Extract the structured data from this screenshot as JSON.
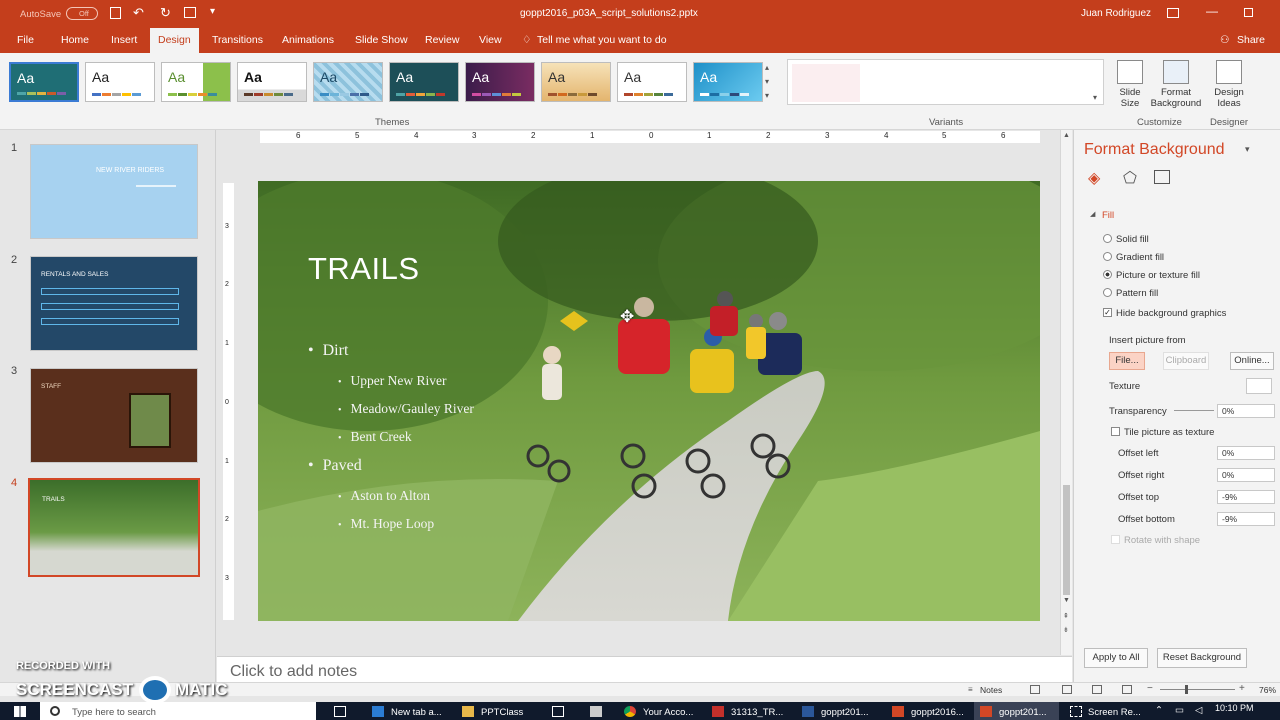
{
  "titlebar": {
    "autosave_label": "AutoSave",
    "autosave_state": "Off",
    "filename": "goppt2016_p03A_script_solutions2.pptx",
    "user": "Juan Rodriguez"
  },
  "tabs": [
    "File",
    "Home",
    "Insert",
    "Design",
    "Transitions",
    "Animations",
    "Slide Show",
    "Review",
    "View"
  ],
  "active_tab": "Design",
  "tell_me": "Tell me what you want to do",
  "share_label": "Share",
  "ribbon": {
    "themes_label": "Themes",
    "variants_label": "Variants",
    "customize_label": "Customize",
    "designer_label": "Designer",
    "theme_glyph": "Aa",
    "slide_size": "Slide Size",
    "format_background": "Format Background",
    "design_ideas": "Design Ideas"
  },
  "thumbnails": [
    {
      "num": "1",
      "title": "NEW RIVER RIDERS"
    },
    {
      "num": "2",
      "title": "RENTALS AND SALES"
    },
    {
      "num": "3",
      "title": "STAFF"
    },
    {
      "num": "4",
      "title": "TRAILS"
    }
  ],
  "ruler": {
    "h": [
      "6",
      "5",
      "4",
      "3",
      "2",
      "1",
      "0",
      "1",
      "2",
      "3",
      "4",
      "5",
      "6"
    ],
    "v": [
      "3",
      "2",
      "1",
      "0",
      "1",
      "2",
      "3"
    ]
  },
  "slide": {
    "title": "TRAILS",
    "bullets": [
      {
        "text": "Dirt",
        "level": 1
      },
      {
        "text": "Upper New River",
        "level": 2
      },
      {
        "text": "Meadow/Gauley River",
        "level": 2
      },
      {
        "text": "Bent Creek",
        "level": 2
      },
      {
        "text": "Paved",
        "level": 1
      },
      {
        "text": "Aston to Alton",
        "level": 2
      },
      {
        "text": "Mt. Hope Loop",
        "level": 2
      }
    ]
  },
  "notes_placeholder": "Click to add notes",
  "format_pane": {
    "title": "Format Background",
    "section": "Fill",
    "fill_options": [
      "Solid fill",
      "Gradient fill",
      "Picture or texture fill",
      "Pattern fill"
    ],
    "selected_fill": "Picture or texture fill",
    "hide_bg": "Hide background graphics",
    "insert_from": "Insert picture from",
    "file_btn": "File...",
    "clipboard_btn": "Clipboard",
    "online_btn": "Online...",
    "texture": "Texture",
    "transparency": "Transparency",
    "transparency_value": "0%",
    "tile": "Tile picture as texture",
    "offsets": [
      {
        "label": "Offset left",
        "value": "0%"
      },
      {
        "label": "Offset right",
        "value": "0%"
      },
      {
        "label": "Offset top",
        "value": "-9%"
      },
      {
        "label": "Offset bottom",
        "value": "-9%"
      }
    ],
    "rotate": "Rotate with shape",
    "apply_all": "Apply to All",
    "reset": "Reset Background"
  },
  "statusbar": {
    "notes": "Notes",
    "zoom": "76%"
  },
  "watermark": {
    "line1": "RECORDED WITH",
    "line2": "SCREENCAST",
    "line3": "MATIC"
  },
  "taskbar": {
    "search": "Type here to search",
    "items": [
      "New tab a...",
      "PPTClass",
      "Your Acco...",
      "31313_TR...",
      "goppt201...",
      "goppt2016...",
      "goppt201...",
      "Screen Re..."
    ],
    "time": "10:10 PM"
  },
  "colors": {
    "accent": "#c43e1c",
    "pane_title": "#d24726",
    "selection": "#d24726"
  }
}
